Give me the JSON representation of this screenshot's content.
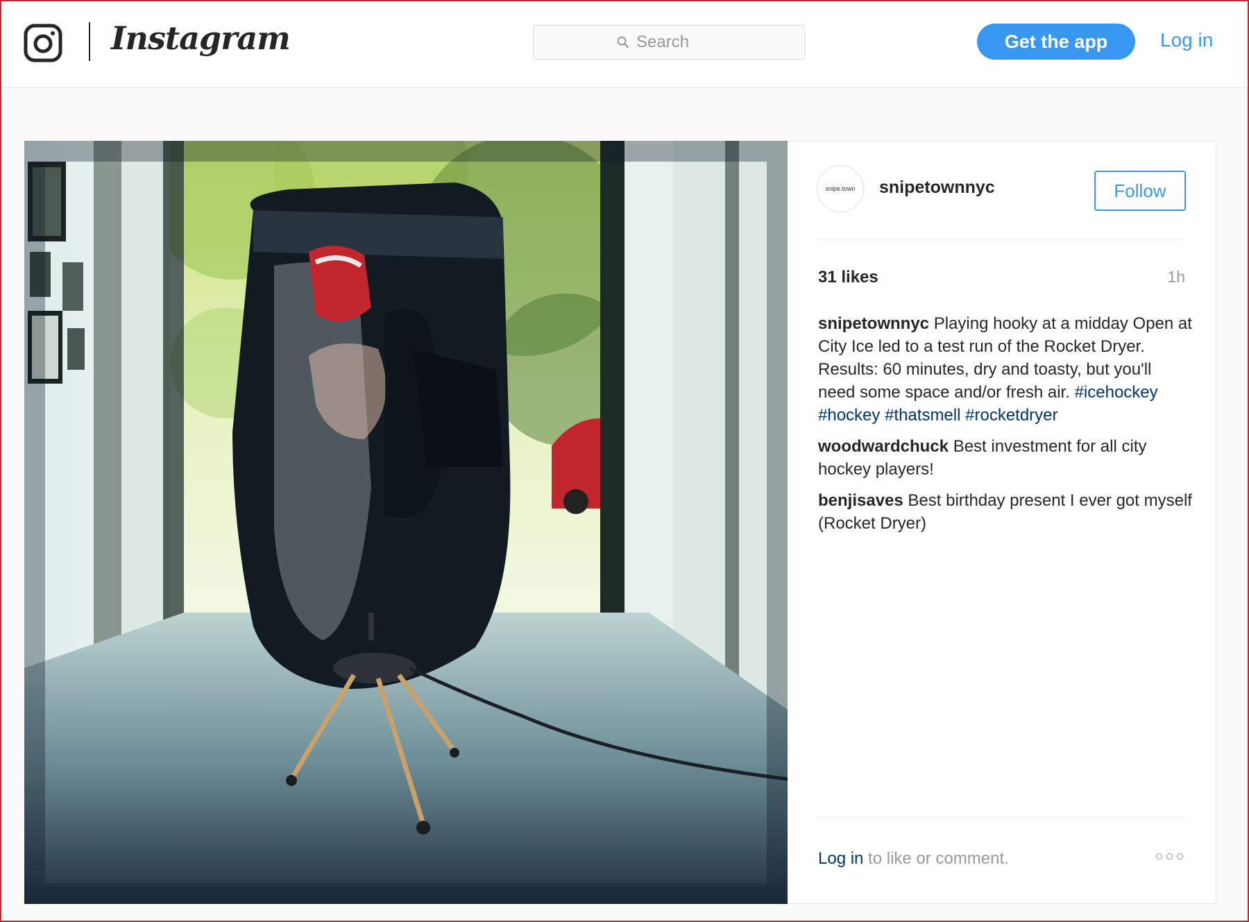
{
  "header": {
    "wordmark": "Instagram",
    "search_placeholder": "Search",
    "get_app_label": "Get the app",
    "login_label": "Log in"
  },
  "post": {
    "image_alt": "Rocket Dryer with hockey gear in garage",
    "avatar_text": "snipe.town",
    "username": "snipetownnyc",
    "follow_label": "Follow",
    "likes": "31 likes",
    "time": "1h",
    "caption": {
      "user": "snipetownnyc",
      "text": "Playing hooky at a midday Open at City Ice led to a test run of the Rocket Dryer. Results: 60 minutes, dry and toasty, but you'll need some space and/or fresh air.",
      "tags": [
        "#icehockey",
        "#hockey",
        "#thatsmell",
        "#rocketdryer"
      ]
    },
    "comments": [
      {
        "user": "woodwardchuck",
        "text": "Best investment for all city hockey players!"
      },
      {
        "user": "benjisaves",
        "text": "Best birthday present I ever got myself (Rocket Dryer)"
      }
    ],
    "footer": {
      "login_link": "Log in",
      "suffix": " to like or comment."
    }
  },
  "colors": {
    "accent": "#3897f0",
    "link": "#003569",
    "frame": "#c0282d"
  }
}
